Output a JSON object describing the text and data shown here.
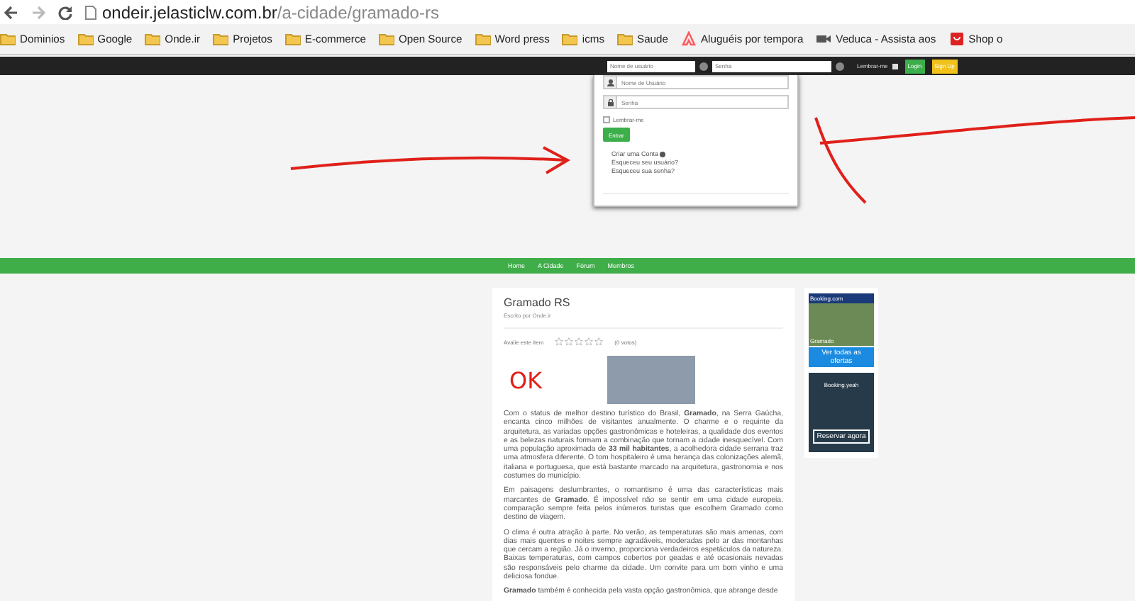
{
  "browser": {
    "address_host": "ondeir.jelasticlw.com.br",
    "address_path": "/a-cidade/gramado-rs",
    "bookmarks": [
      {
        "label": "Dominios",
        "kind": "folder"
      },
      {
        "label": "Google",
        "kind": "folder"
      },
      {
        "label": "Onde.ir",
        "kind": "folder"
      },
      {
        "label": "Projetos",
        "kind": "folder"
      },
      {
        "label": "E-commerce",
        "kind": "folder"
      },
      {
        "label": "Open Source",
        "kind": "folder"
      },
      {
        "label": "Word press",
        "kind": "folder"
      },
      {
        "label": "icms",
        "kind": "folder"
      },
      {
        "label": "Saude",
        "kind": "folder"
      },
      {
        "label": "Aluguéis por tempora",
        "kind": "rental"
      },
      {
        "label": "Veduca - Assista aos",
        "kind": "video"
      },
      {
        "label": "Shop o",
        "kind": "shop"
      }
    ]
  },
  "top_bar": {
    "username_placeholder": "Nome de usuário",
    "password_placeholder": "Senha",
    "remember_label": "Lembrar-me",
    "login": "Login",
    "signup": "Sign Up"
  },
  "login_panel": {
    "username_placeholder": "Nome de Usuário",
    "password_placeholder": "Senha",
    "remember_label": "Lembrar-me",
    "remember_checked": false,
    "submit": "Entrar",
    "links": [
      {
        "label": "Criar uma Conta",
        "kind": "create"
      },
      {
        "label": "Esqueceu seu usuário?",
        "kind": "plain"
      },
      {
        "label": "Esqueceu sua senha?",
        "kind": "plain"
      }
    ]
  },
  "annotation_text": "OK",
  "nav": [
    {
      "label": "Home"
    },
    {
      "label": "A Cidade"
    },
    {
      "label": "Fórum"
    },
    {
      "label": "Membros"
    }
  ],
  "article": {
    "title": "Gramado RS",
    "byline": "Escrito por  Onde.ir",
    "rating_label": "Avalie este item",
    "stars": 0,
    "votes": "(0 votos)",
    "paragraphs": [
      "Com o status de melhor destino turístico do Brasil, **Gramado**, na Serra Gaúcha, encanta cinco milhões de visitantes anualmente. O charme e o requinte da arquitetura, as variadas opções gastronômicas e hoteleiras, a qualidade dos eventos e as belezas naturais formam a combinação que tornam a cidade inesquecível. Com uma população aproximada de **33 mil habitantes**, a acolhedora cidade serrana traz uma atmosfera diferente. O tom hospitaleiro é uma herança das colonizações alemã, italiana e portuguesa, que está bastante marcado na arquitetura, gastronomia e nos costumes do município.",
      "Em paisagens deslumbrantes, o romantismo é uma das características mais marcantes de **Gramado**. É impossível não se sentir em uma cidade europeia, comparação sempre feita pelos inúmeros turistas que escolhem Gramado como destino de viagem.",
      "O clima é outra atração à parte. No verão, as temperaturas são mais amenas, com dias mais quentes e noites sempre agradáveis, moderadas pelo ar das montanhas que cercam a região. Já o inverno, proporciona verdadeiros espetáculos da natureza. Baixas temperaturas, com campos cobertos por geadas e até ocasionais nevadas são responsáveis pelo charme da cidade. Um convite para um bom vinho e uma deliciosa fondue.",
      "**Gramado** também é conhecida pela vasta opção gastronômica, que abrange desde"
    ]
  },
  "ad": {
    "brand": "Booking.com",
    "headline": "Gramado",
    "button": "Ver todas as ofertas",
    "brand_2": "Booking.yeah",
    "button_2": "Reservar agora"
  }
}
